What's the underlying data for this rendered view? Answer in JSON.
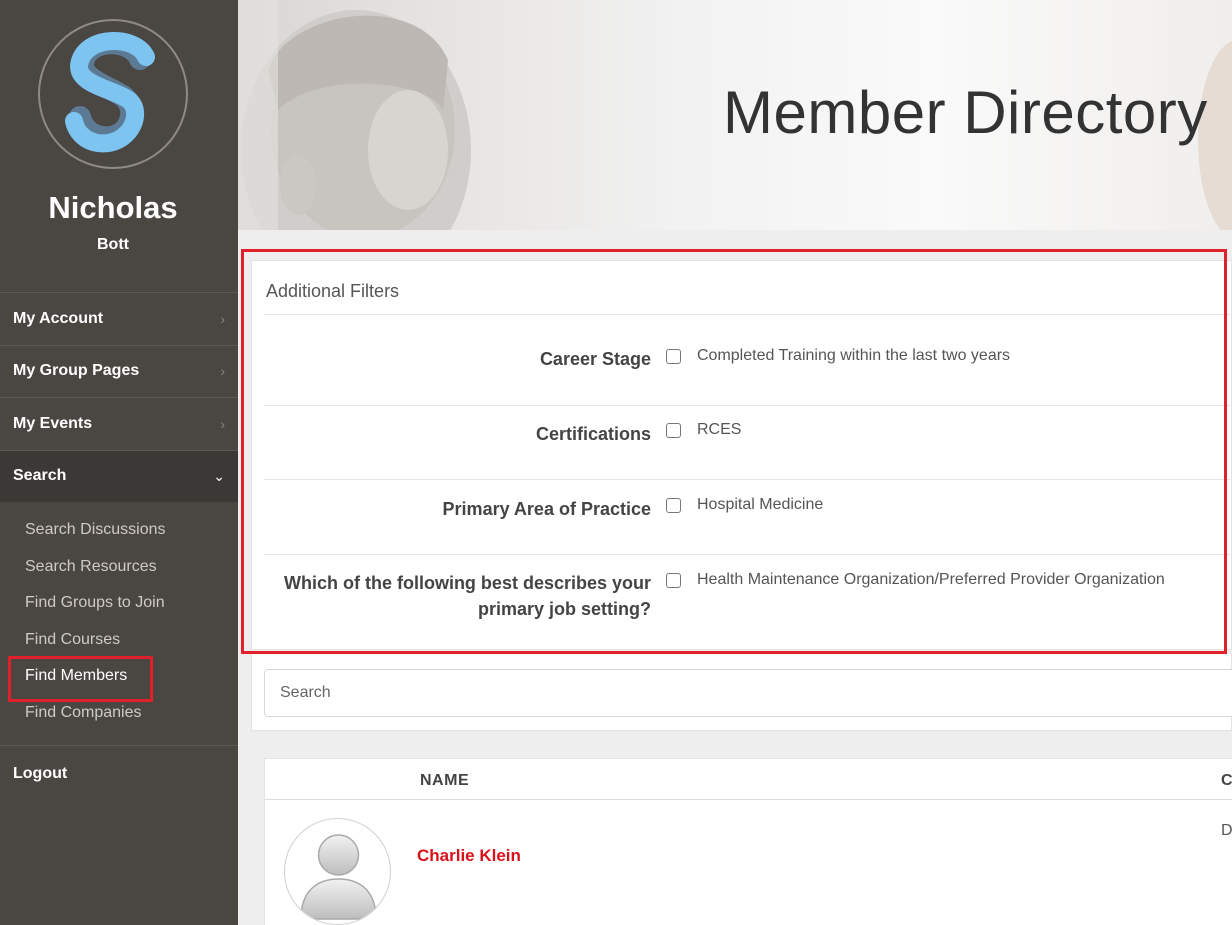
{
  "user": {
    "first_name": "Nicholas",
    "last_name": "Bott"
  },
  "nav": {
    "items": [
      {
        "label": "My Account",
        "chevron": "›"
      },
      {
        "label": "My Group Pages",
        "chevron": "›"
      },
      {
        "label": "My Events",
        "chevron": "›"
      },
      {
        "label": "Search",
        "chevron": "⌄"
      }
    ],
    "search_subitems": [
      "Search Discussions",
      "Search Resources",
      "Find Groups to Join",
      "Find Courses",
      "Find Members",
      "Find Companies"
    ],
    "logout": "Logout"
  },
  "hero": {
    "title": "Member Directory"
  },
  "filters": {
    "heading": "Additional Filters",
    "rows": [
      {
        "label": "Career Stage",
        "option": "Completed Training within the last two years"
      },
      {
        "label": "Certifications",
        "option": "RCES"
      },
      {
        "label": "Primary Area of Practice",
        "option": "Hospital Medicine"
      },
      {
        "label_line1": "Which of the following best describes your",
        "label_line2": "primary job setting?",
        "option": "Health Maintenance Organization/Preferred Provider Organization"
      }
    ]
  },
  "search": {
    "placeholder": "Search"
  },
  "results": {
    "columns": {
      "name": "NAME",
      "second": "C"
    },
    "rows": [
      {
        "name": "Charlie Klein",
        "second": "D"
      }
    ]
  },
  "colors": {
    "sidebar": "#4a4642",
    "accent_red": "#e0202a",
    "logo_blue": "#7ec4f0",
    "member_link": "#d9111b"
  }
}
